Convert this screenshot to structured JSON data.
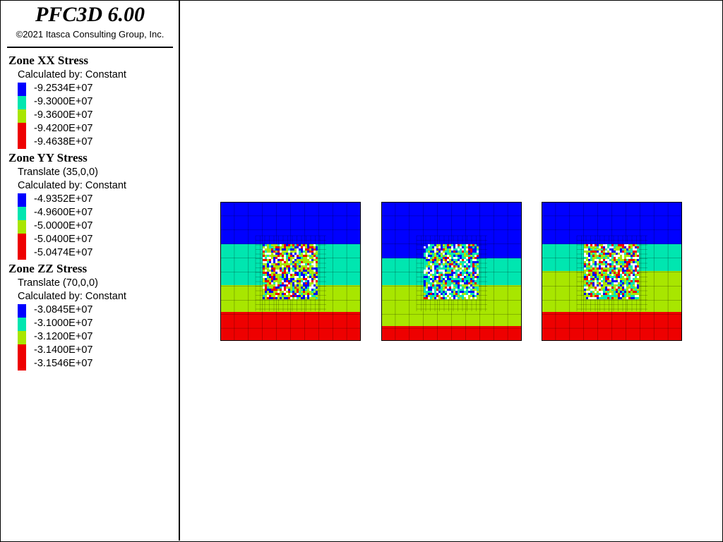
{
  "app": {
    "title": "PFC3D 6.00",
    "copyright": "©2021 Itasca Consulting Group, Inc."
  },
  "legend": {
    "sections": [
      {
        "title": "Zone XX Stress",
        "lines": [
          "Calculated by: Constant"
        ],
        "entries": [
          {
            "color": "#0000ff",
            "label": "-9.2534E+07"
          },
          {
            "color": "#00e6b0",
            "label": "-9.3000E+07"
          },
          {
            "color": "#a8e600",
            "label": "-9.3600E+07"
          },
          {
            "color": "#ee0000",
            "label": "-9.4200E+07"
          },
          {
            "color": "",
            "label": "-9.4638E+07"
          }
        ]
      },
      {
        "title": "Zone YY Stress",
        "lines": [
          "Translate (35,0,0)",
          "Calculated by: Constant"
        ],
        "entries": [
          {
            "color": "#0000ff",
            "label": "-4.9352E+07"
          },
          {
            "color": "#00e6b0",
            "label": "-4.9600E+07"
          },
          {
            "color": "#a8e600",
            "label": "-5.0000E+07"
          },
          {
            "color": "#ee0000",
            "label": "-5.0400E+07"
          },
          {
            "color": "",
            "label": "-5.0474E+07"
          }
        ]
      },
      {
        "title": "Zone ZZ Stress",
        "lines": [
          "Translate (70,0,0)",
          "Calculated by: Constant"
        ],
        "entries": [
          {
            "color": "#0000ff",
            "label": "-3.0845E+07"
          },
          {
            "color": "#00e6b0",
            "label": "-3.1000E+07"
          },
          {
            "color": "#a8e600",
            "label": "-3.1200E+07"
          },
          {
            "color": "#ee0000",
            "label": "-3.1400E+07"
          },
          {
            "color": "",
            "label": "-3.1546E+07"
          }
        ]
      }
    ]
  },
  "colors": {
    "blue": "#0000ff",
    "cyan": "#00e6b0",
    "green": "#a8e600",
    "red": "#ee0000",
    "grid": "#000000"
  }
}
